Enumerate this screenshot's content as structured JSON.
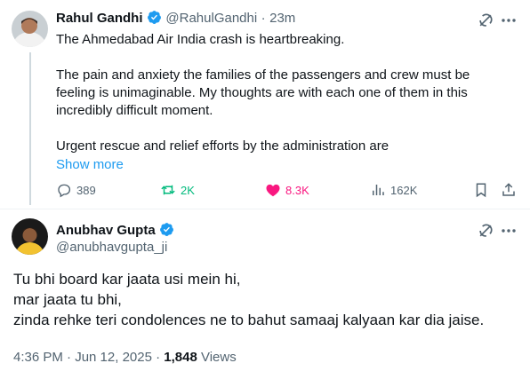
{
  "tweet": {
    "author_name": "Rahul Gandhi",
    "handle": "@RahulGandhi",
    "separator": "·",
    "time": "23m",
    "text_lines": [
      "The Ahmedabad Air India crash is heartbreaking.",
      "The pain and anxiety the families of the passengers and crew must be",
      "feeling is unimaginable. My thoughts are with each one of them in this",
      "incredibly difficult moment.",
      "Urgent rescue and relief efforts by the administration are"
    ],
    "show_more": "Show more",
    "replies": "389",
    "reposts": "2K",
    "likes": "8.3K",
    "views": "162K"
  },
  "reply": {
    "author_name": "Anubhav Gupta",
    "handle": "@anubhavgupta_ji",
    "text_lines": [
      "Tu bhi board kar jaata usi mein hi,",
      "mar jaata tu bhi,",
      "zinda rehke teri condolences ne to bahut samaaj kalyaan kar dia jaise."
    ],
    "timestamp": "4:36 PM · Jun 12, 2025 · ",
    "views_count": "1,848",
    "views_label": " Views"
  },
  "icons": {
    "verified": "verified-badge-icon",
    "grok": "grok-icon",
    "more": "more-icon",
    "reply": "reply-icon",
    "repost": "repost-icon",
    "like": "like-icon",
    "views": "views-icon",
    "bookmark": "bookmark-icon",
    "share": "share-icon"
  },
  "colors": {
    "verified_blue": "#1d9bf0",
    "repost_green": "#00ba7c",
    "like_pink": "#f91880",
    "muted_text": "#536471"
  }
}
